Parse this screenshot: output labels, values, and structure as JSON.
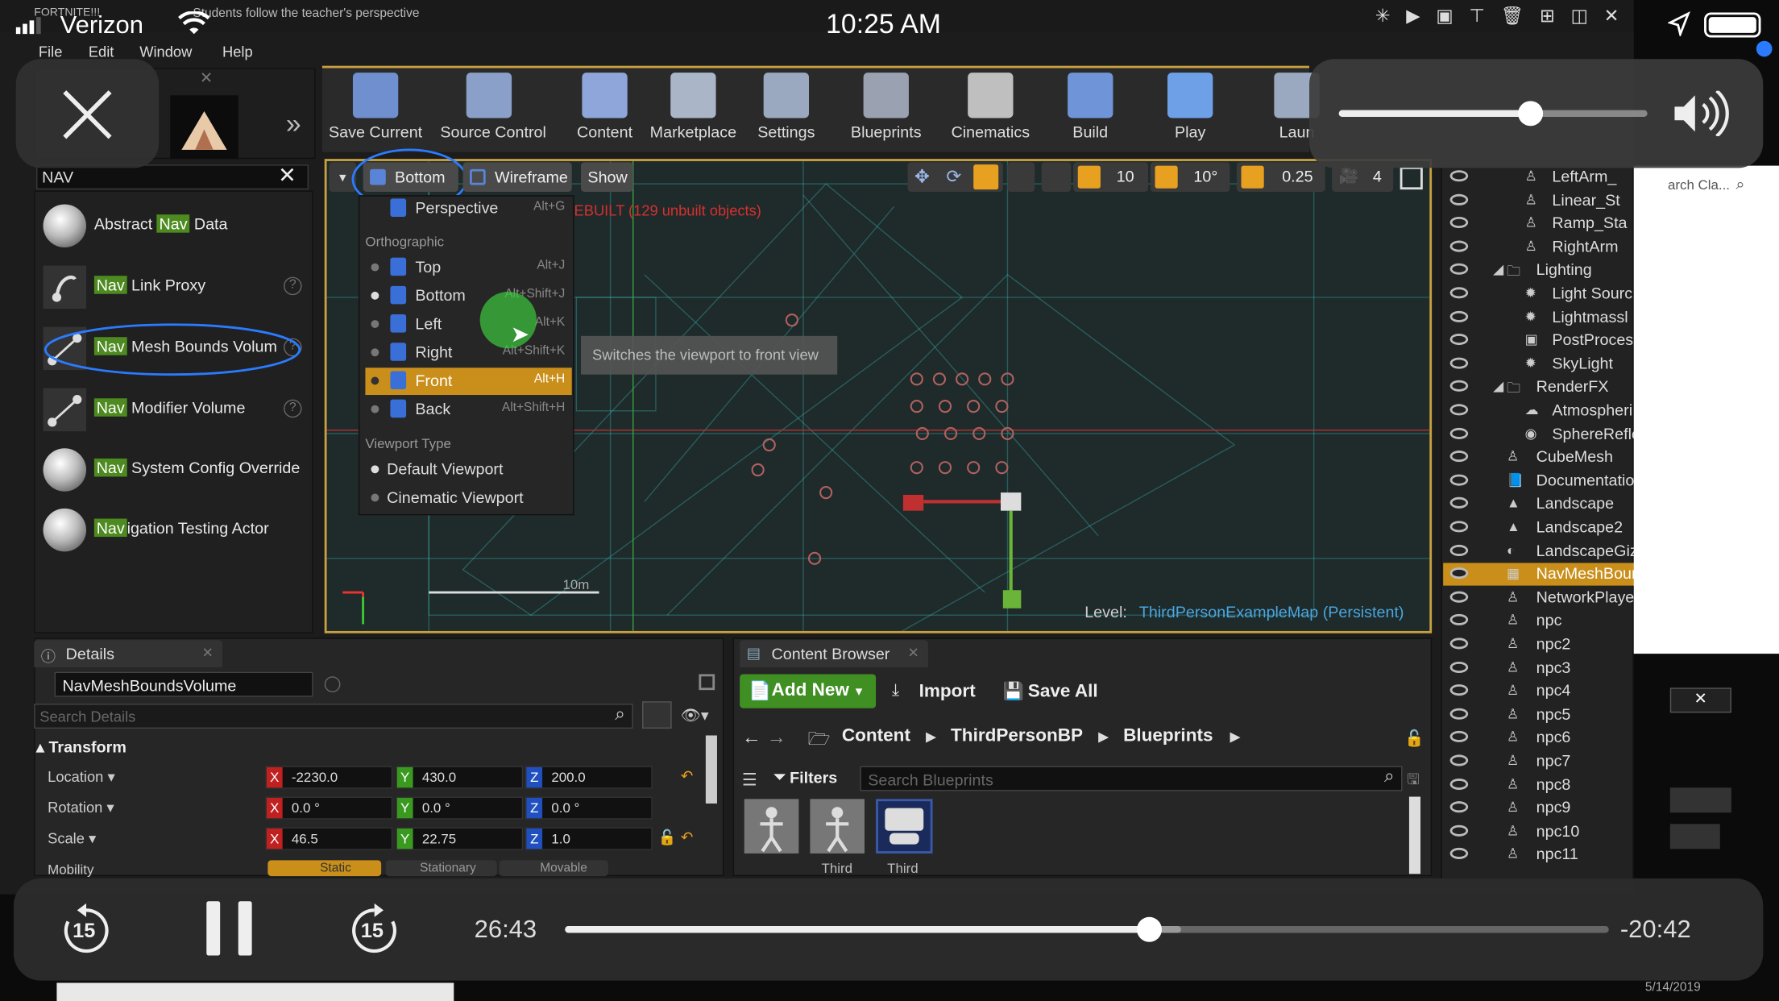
{
  "status_bar": {
    "carrier": "Verizon",
    "time": "10:25 AM",
    "pip_title": "FORTNITE!!!",
    "pip_caption": "Students follow the teacher's perspective"
  },
  "ue_menu": [
    "File",
    "Edit",
    "Window",
    "Help"
  ],
  "toolbar": [
    {
      "label": "Save Current",
      "icon": "save-icon",
      "color": "#6f8fcf"
    },
    {
      "label": "Source Control",
      "icon": "source-control-icon",
      "color": "#8aa0c8"
    },
    {
      "label": "Content",
      "icon": "content-grid-icon",
      "color": "#8ea6d9"
    },
    {
      "label": "Marketplace",
      "icon": "marketplace-icon",
      "color": "#aab6c8"
    },
    {
      "label": "Settings",
      "icon": "settings-gear-icon",
      "color": "#9aa8c0"
    },
    {
      "label": "Blueprints",
      "icon": "blueprints-gamepad-icon",
      "color": "#9aa2b2"
    },
    {
      "label": "Cinematics",
      "icon": "cinematics-clapper-icon",
      "color": "#bfbfbf"
    },
    {
      "label": "Build",
      "icon": "build-icon",
      "color": "#6f95d8"
    },
    {
      "label": "Play",
      "icon": "play-icon",
      "color": "#6ea0e8"
    },
    {
      "label": "Laun",
      "icon": "launch-icon",
      "color": "#9aa8c0"
    }
  ],
  "place_panel": {
    "search_value": "NAV",
    "items": [
      {
        "hl": "Nav",
        "rest_pre": "Abstract ",
        "rest_post": " Data"
      },
      {
        "hl": "Nav",
        "rest_pre": "",
        "rest_post": " Link Proxy"
      },
      {
        "hl": "Nav",
        "rest_pre": "",
        "rest_post": " Mesh Bounds Volum"
      },
      {
        "hl": "Nav",
        "rest_pre": "",
        "rest_post": " Modifier Volume"
      },
      {
        "hl": "Nav",
        "rest_pre": "",
        "rest_post": " System Config Override"
      },
      {
        "hl": "Nav",
        "rest_pre": "",
        "rest_post": "igation Testing Actor"
      }
    ]
  },
  "viewport": {
    "view_button": "Bottom",
    "mode_button": "Wireframe",
    "show_button": "Show",
    "snap_grid": "10",
    "snap_rot": "10°",
    "snap_scale": "0.25",
    "cam_speed": "4",
    "rebuild_warning": "EBUILT (129 unbuilt objects)",
    "tooltip": "Switches the viewport to front view",
    "scale_label": "10m",
    "level_label": "Level:",
    "level_name": "ThirdPersonExampleMap (Persistent)",
    "perspective": {
      "label": "Perspective",
      "shortcut": "Alt+G"
    },
    "ortho_header": "Orthographic",
    "ortho_items": [
      {
        "label": "Top",
        "shortcut": "Alt+J"
      },
      {
        "label": "Bottom",
        "shortcut": "Alt+Shift+J"
      },
      {
        "label": "Left",
        "shortcut": "Alt+K"
      },
      {
        "label": "Right",
        "shortcut": "Alt+Shift+K"
      },
      {
        "label": "Front",
        "shortcut": "Alt+H"
      },
      {
        "label": "Back",
        "shortcut": "Alt+Shift+H"
      }
    ],
    "vt_header": "Viewport Type",
    "vt_items": [
      "Default Viewport",
      "Cinematic Viewport"
    ]
  },
  "details": {
    "tab": "Details",
    "name_value": "NavMeshBoundsVolume",
    "search_placeholder": "Search Details",
    "section": "Transform",
    "rows": [
      {
        "label": "Location",
        "x": "-2230.0",
        "y": "430.0",
        "z": "200.0"
      },
      {
        "label": "Rotation",
        "x": "0.0 °",
        "y": "0.0 °",
        "z": "0.0 °"
      },
      {
        "label": "Scale",
        "x": "46.5",
        "y": "22.75",
        "z": "1.0"
      }
    ],
    "mobility_label": "Mobility",
    "mobility_options": [
      "Static",
      "Stationary",
      "Movable"
    ]
  },
  "content_browser": {
    "tab": "Content Browser",
    "add_new": "Add New",
    "import": "Import",
    "save_all": "Save All",
    "path": [
      "Content",
      "ThirdPersonBP",
      "Blueprints"
    ],
    "filters": "Filters",
    "search_placeholder": "Search Blueprints",
    "assets": [
      "",
      "Third",
      "Third"
    ]
  },
  "outliner": {
    "search_placeholder": "arch Cla...",
    "rows": [
      {
        "label": "LeftArm_",
        "indent": 2,
        "icon": "actor-icon"
      },
      {
        "label": "Linear_St",
        "indent": 2,
        "icon": "actor-icon"
      },
      {
        "label": "Ramp_Sta",
        "indent": 2,
        "icon": "actor-icon"
      },
      {
        "label": "RightArm",
        "indent": 2,
        "icon": "actor-icon"
      },
      {
        "label": "Lighting",
        "indent": 1,
        "icon": "folder-icon"
      },
      {
        "label": "Light Sourc",
        "indent": 2,
        "icon": "light-icon"
      },
      {
        "label": "Lightmassl",
        "indent": 2,
        "icon": "light-icon"
      },
      {
        "label": "PostProces",
        "indent": 2,
        "icon": "postprocess-icon"
      },
      {
        "label": "SkyLight",
        "indent": 2,
        "icon": "light-icon"
      },
      {
        "label": "RenderFX",
        "indent": 1,
        "icon": "folder-icon"
      },
      {
        "label": "Atmospheri",
        "indent": 2,
        "icon": "atmosphere-icon"
      },
      {
        "label": "SphereRefle",
        "indent": 2,
        "icon": "sphere-icon"
      },
      {
        "label": "CubeMesh",
        "indent": 1,
        "icon": "actor-icon"
      },
      {
        "label": "Documentatio",
        "indent": 1,
        "icon": "doc-icon"
      },
      {
        "label": "Landscape",
        "indent": 1,
        "icon": "landscape-icon"
      },
      {
        "label": "Landscape2",
        "indent": 1,
        "icon": "landscape-icon"
      },
      {
        "label": "LandscapeGiz",
        "indent": 1,
        "icon": "gizmo-icon"
      },
      {
        "label": "NavMeshBour",
        "indent": 1,
        "icon": "navmesh-icon",
        "selected": true
      },
      {
        "label": "NetworkPlaye",
        "indent": 1,
        "icon": "actor-icon"
      },
      {
        "label": "npc",
        "indent": 1,
        "icon": "npc-icon"
      },
      {
        "label": "npc2",
        "indent": 1,
        "icon": "npc-icon"
      },
      {
        "label": "npc3",
        "indent": 1,
        "icon": "npc-icon"
      },
      {
        "label": "npc4",
        "indent": 1,
        "icon": "npc-icon"
      },
      {
        "label": "npc5",
        "indent": 1,
        "icon": "npc-icon"
      },
      {
        "label": "npc6",
        "indent": 1,
        "icon": "npc-icon"
      },
      {
        "label": "npc7",
        "indent": 1,
        "icon": "npc-icon"
      },
      {
        "label": "npc8",
        "indent": 1,
        "icon": "npc-icon"
      },
      {
        "label": "npc9",
        "indent": 1,
        "icon": "npc-icon"
      },
      {
        "label": "npc10",
        "indent": 1,
        "icon": "npc-icon"
      },
      {
        "label": "npc11",
        "indent": 1,
        "icon": "npc-icon"
      }
    ]
  },
  "player": {
    "elapsed": "26:43",
    "remaining": "-20:42",
    "progress": 0.56,
    "buffered": 0.59,
    "volume": 0.62,
    "skip_back": "15",
    "skip_fwd": "15",
    "taskbar_date": "5/14/2019"
  }
}
